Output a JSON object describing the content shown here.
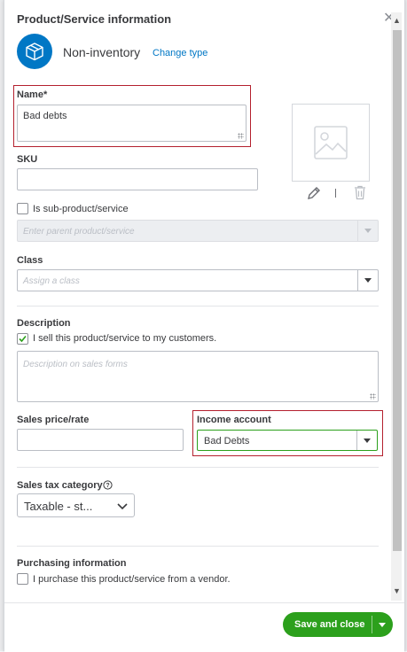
{
  "header": {
    "title": "Product/Service information",
    "type_label": "Non-inventory",
    "change_type": "Change type"
  },
  "name": {
    "label": "Name*",
    "value": "Bad debts"
  },
  "sku": {
    "label": "SKU",
    "value": ""
  },
  "sub_product": {
    "label": "Is sub-product/service",
    "checked": false,
    "placeholder": "Enter parent product/service"
  },
  "class": {
    "label": "Class",
    "placeholder": "Assign a class"
  },
  "description": {
    "label": "Description",
    "sell_label": "I sell this product/service to my customers.",
    "sell_checked": true,
    "placeholder": "Description on sales forms"
  },
  "sales_price": {
    "label": "Sales price/rate",
    "value": ""
  },
  "income_account": {
    "label": "Income account",
    "value": "Bad Debts"
  },
  "sales_tax": {
    "label": "Sales tax category",
    "value": "Taxable - st..."
  },
  "purchasing": {
    "label": "Purchasing information",
    "purchase_label": "I purchase this product/service from a vendor.",
    "checked": false
  },
  "footer": {
    "save_label": "Save and close"
  },
  "icons": {
    "close": "close-icon",
    "type": "box-icon",
    "image": "image-placeholder-icon",
    "edit": "pencil-icon",
    "delete": "trash-icon",
    "help": "help-icon"
  },
  "colors": {
    "accent": "#0077c5",
    "primary_button": "#2ca01c",
    "highlight": "#b4202e"
  }
}
